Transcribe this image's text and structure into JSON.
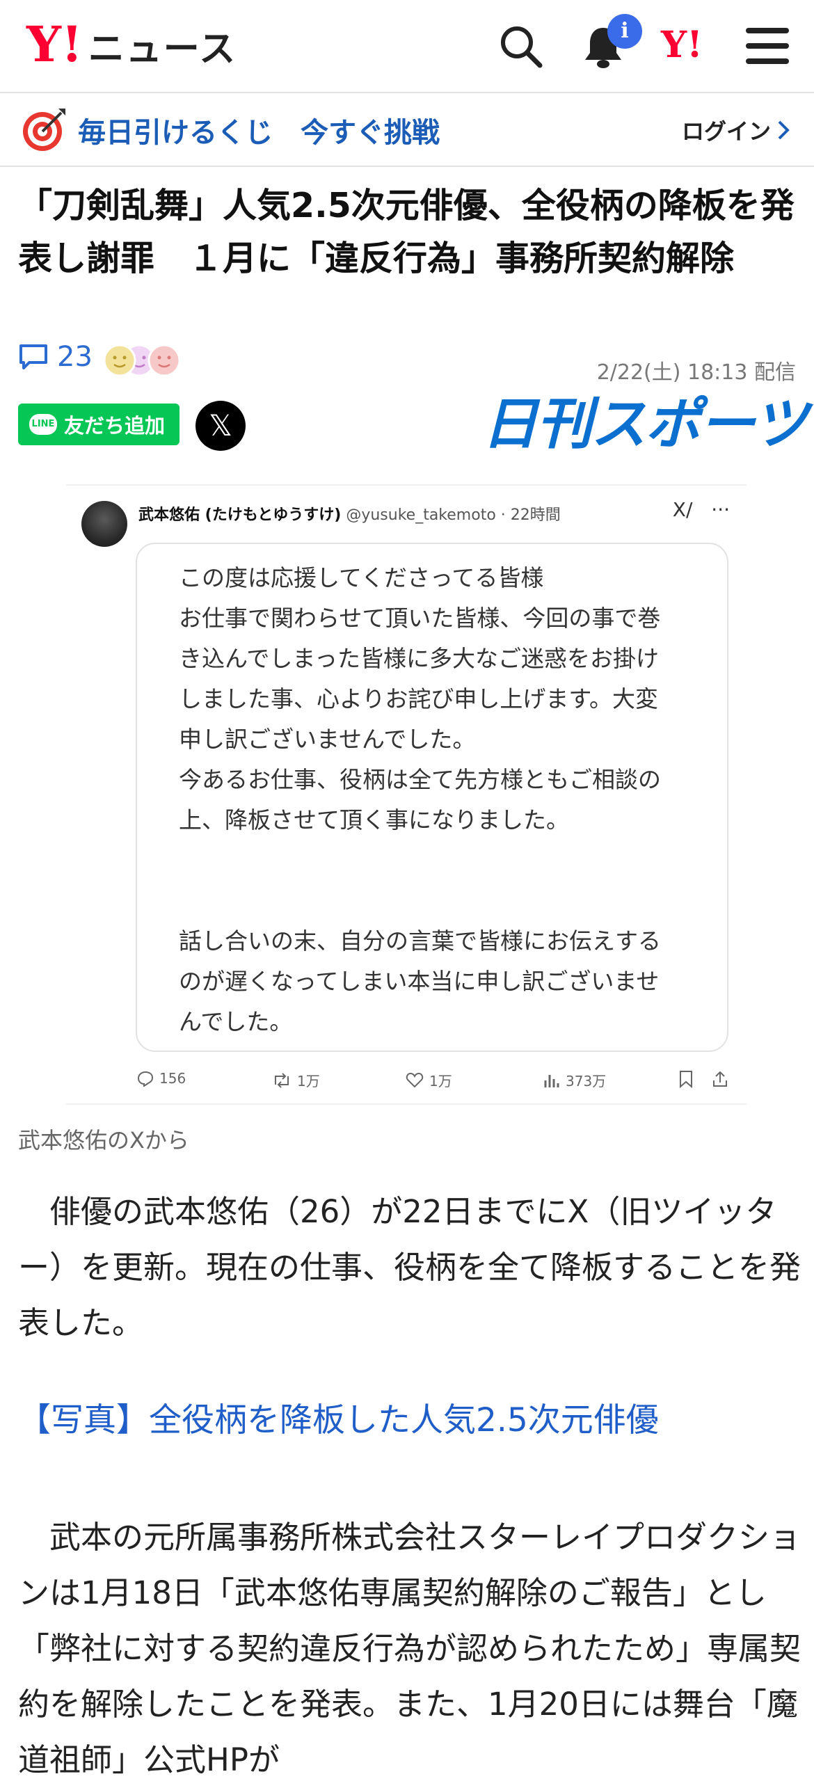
{
  "header": {
    "logo_mark": "Y!",
    "logo_text": "ニュース",
    "notification_badge": "i",
    "yahoo_icon_text": "Y!"
  },
  "campaign": {
    "text": "毎日引けるくじ　今すぐ挑戦",
    "login": "ログイン"
  },
  "article": {
    "title": "「刀剣乱舞」人気2.5次元俳優、全役柄の降板を発表し謝罪　１月に「違反行為」事務所契約解除",
    "comment_count": "23",
    "date": "2/22(土) 18:13 配信",
    "line_button": "友だち追加",
    "line_chip": "LINE",
    "x_button": "𝕏",
    "source": "日刊スポーツ"
  },
  "tweet": {
    "name": "武本悠佑 (たけもとゆうすけ)",
    "meta": "@yusuke_takemoto · 22時間",
    "grok": "X/",
    "more": "···",
    "lines_a": [
      "この度は応援してくださってる皆様",
      "お仕事で関わらせて頂いた皆様、今回の事で巻",
      "き込んでしまった皆様に多大なご迷惑をお掛け",
      "しました事、心よりお詫び申し上げます。大変",
      "申し訳ございませんでした。",
      "今あるお仕事、役柄は全て先方様ともご相談の",
      "上、降板させて頂く事になりました。"
    ],
    "lines_b": [
      "話し合いの末、自分の言葉で皆様にお伝えする",
      "のが遅くなってしまい本当に申し訳ございませ",
      "んでした。"
    ],
    "stats": {
      "replies": "156",
      "retweets": "1万",
      "likes": "1万",
      "views": "373万"
    }
  },
  "caption": "武本悠佑のXから",
  "paragraph1": "　俳優の武本悠佑（26）が22日までにX（旧ツイッター）を更新。現在の仕事、役柄を全て降板することを発表した。",
  "photo_link": "【写真】全役柄を降板した人気2.5次元俳優",
  "paragraph2": "　武本の元所属事務所株式会社スターレイプロダクションは1月18日「武本悠佑専属契約解除のご報告」とし「弊社に対する契約違反行為が認められたため」専属契約を解除したことを発表。また、1月20日には舞台「魔道祖師」公式HPが",
  "colors": {
    "accent_blue": "#1b5db6",
    "brand_red": "#ff0033",
    "line_green": "#06c755"
  }
}
